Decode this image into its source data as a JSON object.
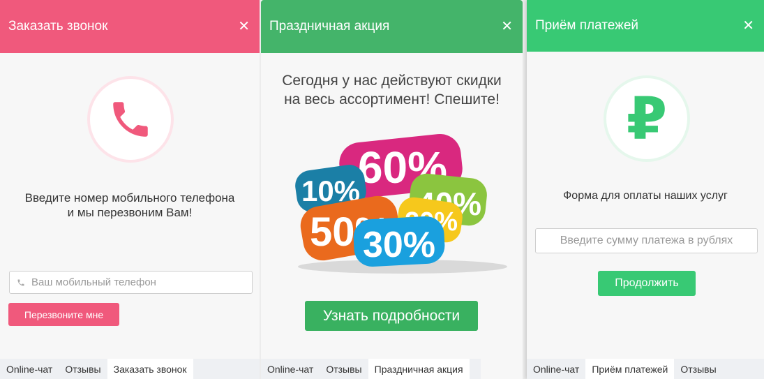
{
  "callback": {
    "title": "Заказать звонок",
    "message_line1": "Введите номер мобильного телефона",
    "message_line2": "и мы перезвоним Вам!",
    "phone_placeholder": "Ваш мобильный телефон",
    "submit_label": "Перезвоните мне",
    "tabs": [
      {
        "label": "Online-чат",
        "active": false
      },
      {
        "label": "Отзывы",
        "active": false
      },
      {
        "label": "Заказать звонок",
        "active": true
      }
    ]
  },
  "promo": {
    "title": "Праздничная акция",
    "message_line1": "Сегодня у нас действуют скидки",
    "message_line2": "на весь ассортимент! Спешите!",
    "badges": [
      "60%",
      "10%",
      "40%",
      "50%",
      "20%",
      "30%"
    ],
    "cta_label": "Узнать подробности",
    "tabs": [
      {
        "label": "Online-чат",
        "active": false
      },
      {
        "label": "Отзывы",
        "active": false
      },
      {
        "label": "Праздничная акция",
        "active": true
      }
    ]
  },
  "payment": {
    "title": "Приём платежей",
    "currency_symbol": "₽",
    "message": "Форма для оплаты наших услуг",
    "amount_placeholder": "Введите сумму платежа в рублях",
    "submit_label": "Продолжить",
    "tabs": [
      {
        "label": "Online-чат",
        "active": false
      },
      {
        "label": "Приём платежей",
        "active": true
      },
      {
        "label": "Отзывы",
        "active": false
      }
    ]
  },
  "colors": {
    "callback_accent": "#f0597c",
    "promo_accent": "#44b46a",
    "payment_accent": "#38c974"
  }
}
